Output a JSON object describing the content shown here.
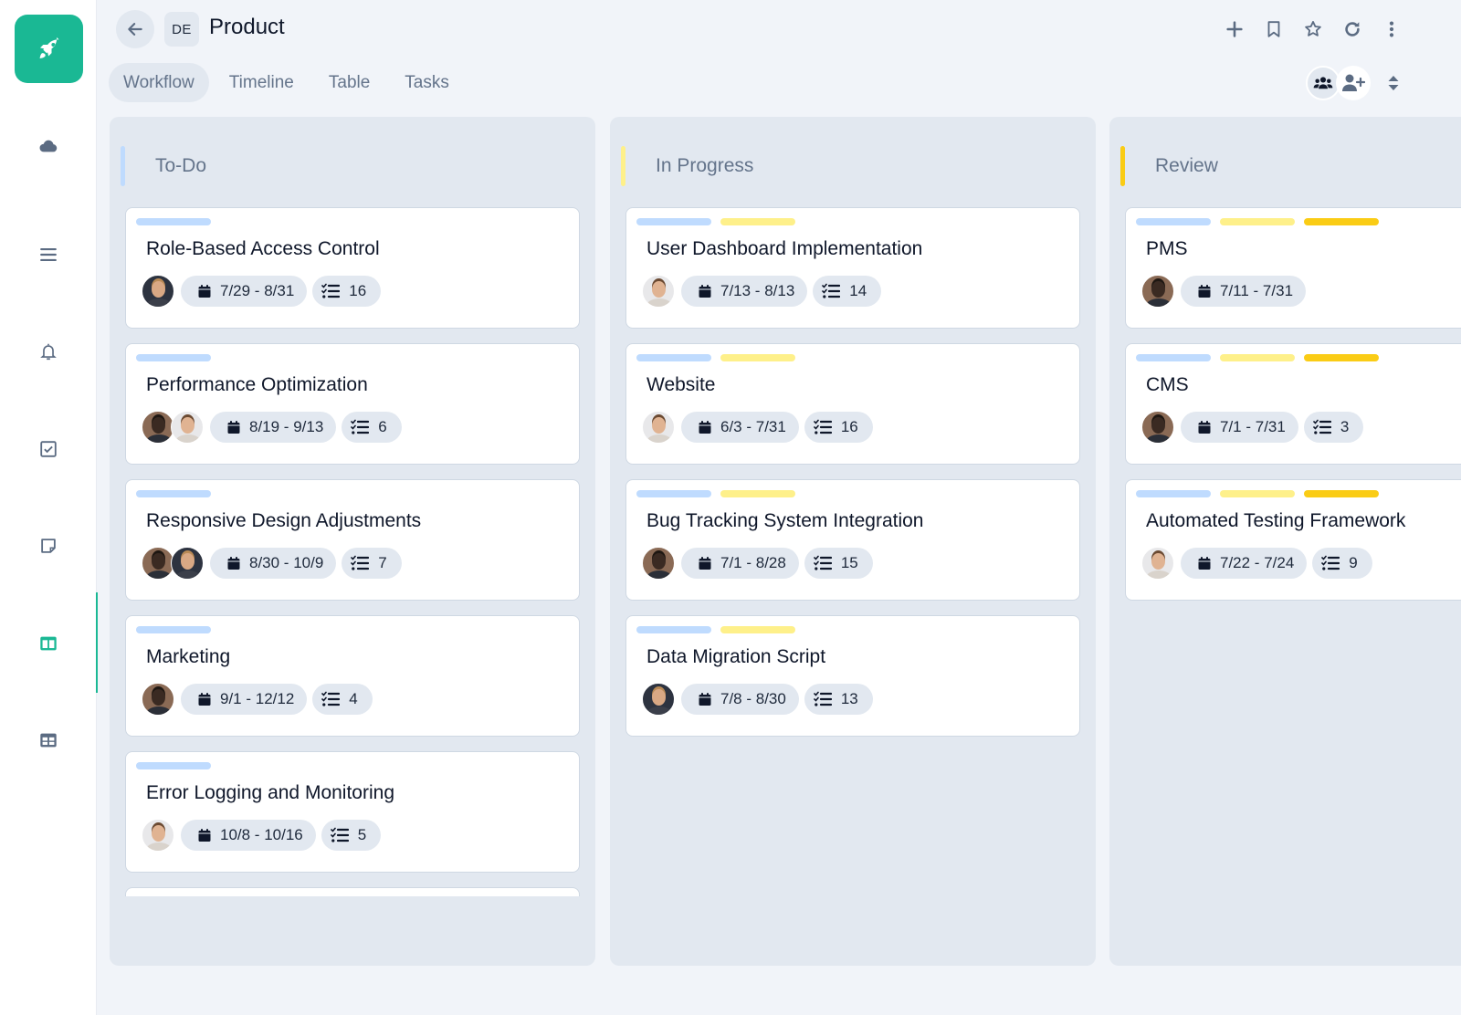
{
  "app": {
    "brand_color": "#1ab894",
    "logo_icon": "rocket-icon"
  },
  "sidebar": {
    "items": [
      {
        "name": "cloud",
        "icon": "cloud-icon",
        "active": false
      },
      {
        "name": "menu",
        "icon": "hamburger-icon",
        "active": false
      },
      {
        "name": "notifications",
        "icon": "bell-icon",
        "active": false
      },
      {
        "name": "tasks",
        "icon": "checkbox-icon",
        "active": false
      },
      {
        "name": "notes",
        "icon": "sticky-note-icon",
        "active": false
      },
      {
        "name": "board",
        "icon": "columns-icon",
        "active": true
      },
      {
        "name": "table",
        "icon": "table-icon",
        "active": false
      }
    ]
  },
  "header": {
    "back_icon": "arrow-left-icon",
    "workspace_badge": "DE",
    "title": "Product",
    "actions": [
      {
        "name": "add",
        "icon": "plus-icon"
      },
      {
        "name": "bookmark",
        "icon": "bookmark-icon"
      },
      {
        "name": "favorite",
        "icon": "star-icon"
      },
      {
        "name": "refresh",
        "icon": "refresh-icon"
      },
      {
        "name": "more",
        "icon": "more-vertical-icon"
      }
    ],
    "tabs": [
      {
        "label": "Workflow",
        "active": true
      },
      {
        "label": "Timeline",
        "active": false
      },
      {
        "label": "Table",
        "active": false
      },
      {
        "label": "Tasks",
        "active": false
      }
    ],
    "team_icon": "users-icon",
    "add_member_icon": "user-plus-icon",
    "sort_icon": "sort-icon"
  },
  "colors": {
    "tag_blue": "#bfdbfe",
    "tag_yellow": "#fef08a",
    "tag_amber": "#facc15"
  },
  "columns": [
    {
      "title": "To-Do",
      "color": "#bfdbfe",
      "cards": [
        {
          "title": "Role-Based Access Control",
          "tags": [
            "tag_blue"
          ],
          "avatars": [
            "woman-blonde"
          ],
          "dates": "7/29 - 8/31",
          "tasks": "16"
        },
        {
          "title": "Performance Optimization",
          "tags": [
            "tag_blue"
          ],
          "avatars": [
            "man-dark",
            "man-light"
          ],
          "dates": "8/19 - 9/13",
          "tasks": "6"
        },
        {
          "title": "Responsive Design Adjustments",
          "tags": [
            "tag_blue"
          ],
          "avatars": [
            "man-dark",
            "woman-blonde"
          ],
          "dates": "8/30 - 10/9",
          "tasks": "7"
        },
        {
          "title": "Marketing",
          "tags": [
            "tag_blue"
          ],
          "avatars": [
            "man-dark"
          ],
          "dates": "9/1 - 12/12",
          "tasks": "4"
        },
        {
          "title": "Error Logging and Monitoring",
          "tags": [
            "tag_blue"
          ],
          "avatars": [
            "man-light"
          ],
          "dates": "10/8 - 10/16",
          "tasks": "5"
        }
      ],
      "has_more": true
    },
    {
      "title": "In Progress",
      "color": "#fef08a",
      "cards": [
        {
          "title": "User Dashboard Implementation",
          "tags": [
            "tag_blue",
            "tag_yellow"
          ],
          "avatars": [
            "man-light"
          ],
          "dates": "7/13 - 8/13",
          "tasks": "14"
        },
        {
          "title": "Website",
          "tags": [
            "tag_blue",
            "tag_yellow"
          ],
          "avatars": [
            "man-light"
          ],
          "dates": "6/3 - 7/31",
          "tasks": "16"
        },
        {
          "title": "Bug Tracking System Integration",
          "tags": [
            "tag_blue",
            "tag_yellow"
          ],
          "avatars": [
            "man-dark"
          ],
          "dates": "7/1 - 8/28",
          "tasks": "15"
        },
        {
          "title": "Data Migration Script",
          "tags": [
            "tag_blue",
            "tag_yellow"
          ],
          "avatars": [
            "woman-blonde"
          ],
          "dates": "7/8 - 8/30",
          "tasks": "13"
        }
      ],
      "has_more": false
    },
    {
      "title": "Review",
      "color": "#facc15",
      "cards": [
        {
          "title": "PMS",
          "tags": [
            "tag_blue",
            "tag_yellow",
            "tag_amber"
          ],
          "avatars": [
            "man-dark"
          ],
          "dates": "7/11 - 7/31",
          "tasks": null
        },
        {
          "title": "CMS",
          "tags": [
            "tag_blue",
            "tag_yellow",
            "tag_amber"
          ],
          "avatars": [
            "man-dark"
          ],
          "dates": "7/1 - 7/31",
          "tasks": "3"
        },
        {
          "title": "Automated Testing Framework",
          "tags": [
            "tag_blue",
            "tag_yellow",
            "tag_amber"
          ],
          "avatars": [
            "man-light"
          ],
          "dates": "7/22 - 7/24",
          "tasks": "9"
        }
      ],
      "has_more": false
    }
  ]
}
